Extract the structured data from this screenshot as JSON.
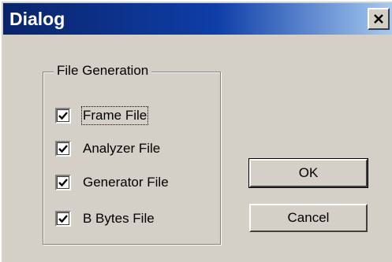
{
  "window": {
    "title": "Dialog",
    "close_icon": "close-icon"
  },
  "group": {
    "label": "File Generation",
    "checkboxes": [
      {
        "label": "Frame File",
        "checked": true,
        "focused": true
      },
      {
        "label": "Analyzer File",
        "checked": true
      },
      {
        "label": "Generator File",
        "checked": true
      },
      {
        "label": "B Bytes File",
        "checked": true
      }
    ]
  },
  "buttons": {
    "ok": "OK",
    "cancel": "Cancel"
  },
  "colors": {
    "face": "#d4d0c8",
    "titlebar_start": "#0a246a",
    "titlebar_end": "#a6caf0"
  }
}
